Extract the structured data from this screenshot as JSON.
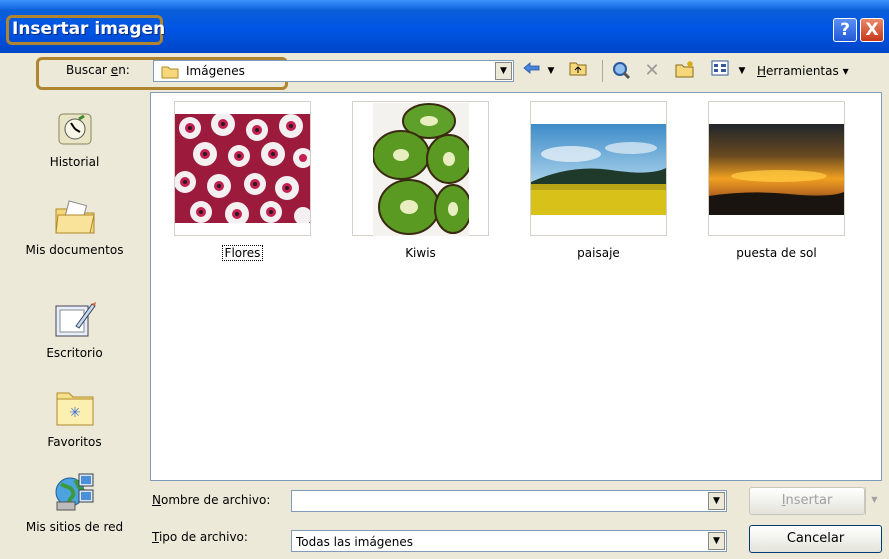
{
  "dialog": {
    "title": "Insertar imagen",
    "help_glyph": "?",
    "close_glyph": "X"
  },
  "toolbar": {
    "lookin_label_prefix": "Buscar ",
    "lookin_label_accel": "e",
    "lookin_label_suffix": "n:",
    "lookin_value": "Imágenes",
    "tools_label_accel": "H",
    "tools_label_rest": "erramientas",
    "tools_arrow": "▾",
    "icons": [
      "back-arrow-icon",
      "up-folder-icon",
      "search-web-icon",
      "delete-icon",
      "new-folder-icon",
      "views-icon"
    ]
  },
  "places": [
    {
      "id": "historial",
      "label": "Historial",
      "icon": "history-icon"
    },
    {
      "id": "mis-documentos",
      "label": "Mis documentos",
      "icon": "my-documents-icon"
    },
    {
      "id": "escritorio",
      "label": "Escritorio",
      "icon": "desktop-icon"
    },
    {
      "id": "favoritos",
      "label": "Favoritos",
      "icon": "favorites-icon"
    },
    {
      "id": "mis-sitios-de-red",
      "label": "Mis sitios de red",
      "icon": "network-places-icon"
    }
  ],
  "files": [
    {
      "name": "Flores",
      "selected": true
    },
    {
      "name": "Kiwis",
      "selected": false
    },
    {
      "name": "paisaje",
      "selected": false
    },
    {
      "name": "puesta de sol",
      "selected": false
    }
  ],
  "filename": {
    "label_accel": "N",
    "label_rest": "ombre de archivo:",
    "value": ""
  },
  "filetype": {
    "label_accel": "T",
    "label_rest": "ipo de archivo:",
    "value": "Todas las imágenes"
  },
  "buttons": {
    "insert_accel": "I",
    "insert_rest": "nsertar",
    "cancel": "Cancelar"
  },
  "colors": {
    "title_highlight": "#b08530",
    "titlebar": "#0055e5"
  }
}
